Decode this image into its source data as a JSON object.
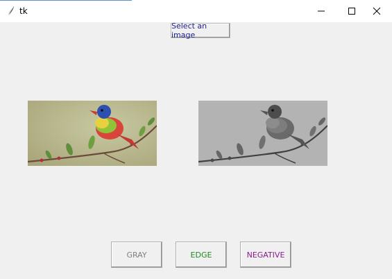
{
  "window": {
    "title": "tk",
    "icon": "feather-icon",
    "controls": [
      "minimize-icon",
      "maximize-icon",
      "close-icon"
    ]
  },
  "toolbar": {
    "select_label": "Select an image",
    "select_color": "#1d1d8f"
  },
  "images": {
    "original": {
      "content": "colorful painted bunting bird on branch"
    },
    "processed": {
      "content": "grayscale version of bird image"
    }
  },
  "actions": {
    "gray_label": "GRAY",
    "gray_color": "#808080",
    "edge_label": "EDGE",
    "edge_color": "#1a8a1a",
    "negative_label": "NEGATIVE",
    "negative_color": "#8a1a8a"
  }
}
